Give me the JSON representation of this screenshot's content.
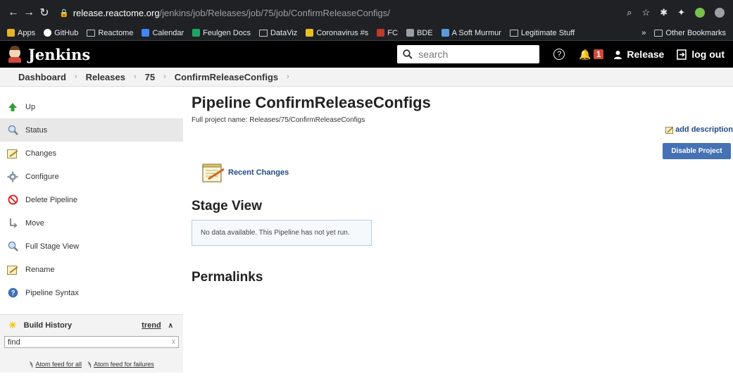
{
  "browser": {
    "url_host": "release.reactome.org",
    "url_path": "/jenkins/job/Releases/job/75/job/ConfirmReleaseConfigs/",
    "bookmarks": [
      {
        "label": "Apps",
        "icon": "apps-grid-icon"
      },
      {
        "label": "GitHub",
        "icon": "github-icon"
      },
      {
        "label": "Reactome",
        "icon": "folder-icon"
      },
      {
        "label": "Calendar",
        "icon": "calendar-icon"
      },
      {
        "label": "Feulgen Docs",
        "icon": "drive-icon"
      },
      {
        "label": "DataViz",
        "icon": "folder-icon"
      },
      {
        "label": "Coronavirus #s",
        "icon": "sheet-icon"
      },
      {
        "label": "FC",
        "icon": "fc-icon"
      },
      {
        "label": "BDE",
        "icon": "bde-icon"
      },
      {
        "label": "A Soft Murmur",
        "icon": "droplet-icon"
      },
      {
        "label": "Legitimate Stuff",
        "icon": "folder-icon"
      }
    ],
    "overflow_label": "»",
    "other_bookmarks": "Other Bookmarks"
  },
  "header": {
    "title": "Jenkins",
    "search_placeholder": "search",
    "notification_count": "1",
    "user": "Release",
    "logout": "log out"
  },
  "breadcrumb": [
    "Dashboard",
    "Releases",
    "75",
    "ConfirmReleaseConfigs"
  ],
  "sidebar": {
    "items": [
      {
        "label": "Up",
        "icon": "up-arrow-icon"
      },
      {
        "label": "Status",
        "icon": "magnifier-icon"
      },
      {
        "label": "Changes",
        "icon": "notepad-icon"
      },
      {
        "label": "Configure",
        "icon": "gear-icon"
      },
      {
        "label": "Delete Pipeline",
        "icon": "no-entry-icon"
      },
      {
        "label": "Move",
        "icon": "move-icon"
      },
      {
        "label": "Full Stage View",
        "icon": "magnifier-icon"
      },
      {
        "label": "Rename",
        "icon": "notepad-icon"
      },
      {
        "label": "Pipeline Syntax",
        "icon": "help-icon"
      }
    ]
  },
  "build_history": {
    "title": "Build History",
    "trend": "trend",
    "find_value": "find",
    "feed_all": "Atom feed for all",
    "feed_failures": "Atom feed for failures"
  },
  "main": {
    "title": "Pipeline ConfirmReleaseConfigs",
    "full_name": "Full project name: Releases/75/ConfirmReleaseConfigs",
    "add_description": "add description",
    "disable_button": "Disable Project",
    "recent_changes": "Recent Changes",
    "stage_view_title": "Stage View",
    "no_data": "No data available. This Pipeline has not yet run.",
    "permalinks_title": "Permalinks"
  }
}
